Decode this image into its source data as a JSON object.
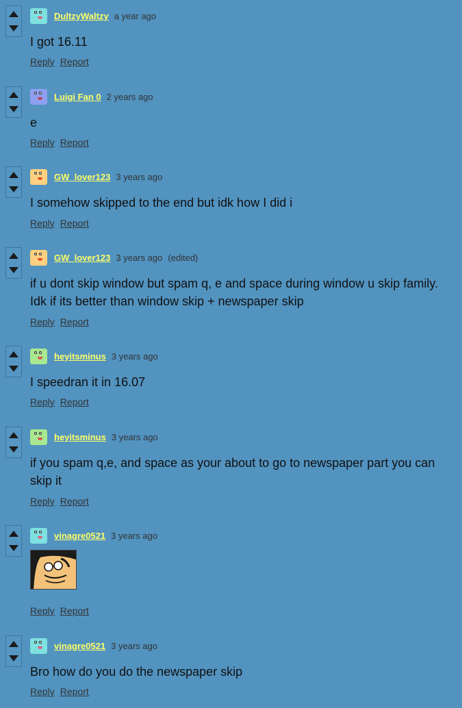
{
  "comments": [
    {
      "username": "DultzyWaltzy",
      "time": "a year ago",
      "edited": "",
      "body": "I got 16.11",
      "reply": "Reply",
      "report": "Report",
      "avatar_color": "#7fe0e0",
      "mouth_color": "#e06080"
    },
    {
      "username": "Luigi Fan 0",
      "time": "2 years ago",
      "edited": "",
      "body": "e",
      "reply": "Reply",
      "report": "Report",
      "avatar_color": "#8f9ff0",
      "mouth_color": "#c04060"
    },
    {
      "username": "GW_lover123",
      "time": "3 years ago",
      "edited": "",
      "body": "I somehow skipped to the end but idk how I did i",
      "reply": "Reply",
      "report": "Report",
      "avatar_color": "#ffd080",
      "mouth_color": "#e05030"
    },
    {
      "username": "GW_lover123",
      "time": "3 years ago",
      "edited": "(edited)",
      "body": "if u dont skip window but spam q, e and space during window u skip family. Idk if its better than window skip + newspaper skip",
      "reply": "Reply",
      "report": "Report",
      "avatar_color": "#ffd080",
      "mouth_color": "#e05030"
    },
    {
      "username": "heyitsminus",
      "time": "3 years ago",
      "edited": "",
      "body": "I speedran it in 16.07",
      "reply": "Reply",
      "report": "Report",
      "avatar_color": "#a8e890",
      "mouth_color": "#e05050"
    },
    {
      "username": "heyitsminus",
      "time": "3 years ago",
      "edited": "",
      "body": "if you spam q,e, and space as your about to go to newspaper part you can skip it",
      "reply": "Reply",
      "report": "Report",
      "avatar_color": "#a8e890",
      "mouth_color": "#e05050"
    },
    {
      "username": "vinagre0521",
      "time": "3 years ago",
      "edited": "",
      "body": "",
      "reply": "Reply",
      "report": "Report",
      "avatar_color": "#7fe0e0",
      "mouth_color": "#e06080"
    },
    {
      "username": "vinagre0521",
      "time": "3 years ago",
      "edited": "",
      "body": "Bro how do you do the newspaper skip",
      "reply": "Reply",
      "report": "Report",
      "avatar_color": "#7fe0e0",
      "mouth_color": "#e06080"
    }
  ]
}
